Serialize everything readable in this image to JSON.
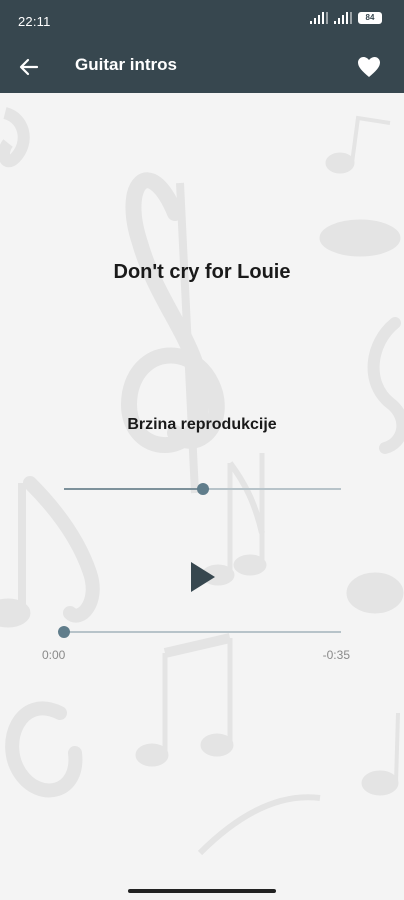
{
  "status_bar": {
    "time": "22:11",
    "battery": "84"
  },
  "app_bar": {
    "title": "Guitar intros",
    "back_icon": "arrow-left-icon",
    "favorite_icon": "heart-icon"
  },
  "player": {
    "song_title": "Don't cry for Louie",
    "speed_label": "Brzina reprodukcije",
    "speed_value_fraction": 0.5,
    "progress_fraction": 0.0,
    "elapsed": "0:00",
    "remaining": "-0:35",
    "play_icon": "play-icon"
  },
  "colors": {
    "app_bar": "#37474f",
    "accent": "#607d8b",
    "background": "#f4f4f4"
  }
}
